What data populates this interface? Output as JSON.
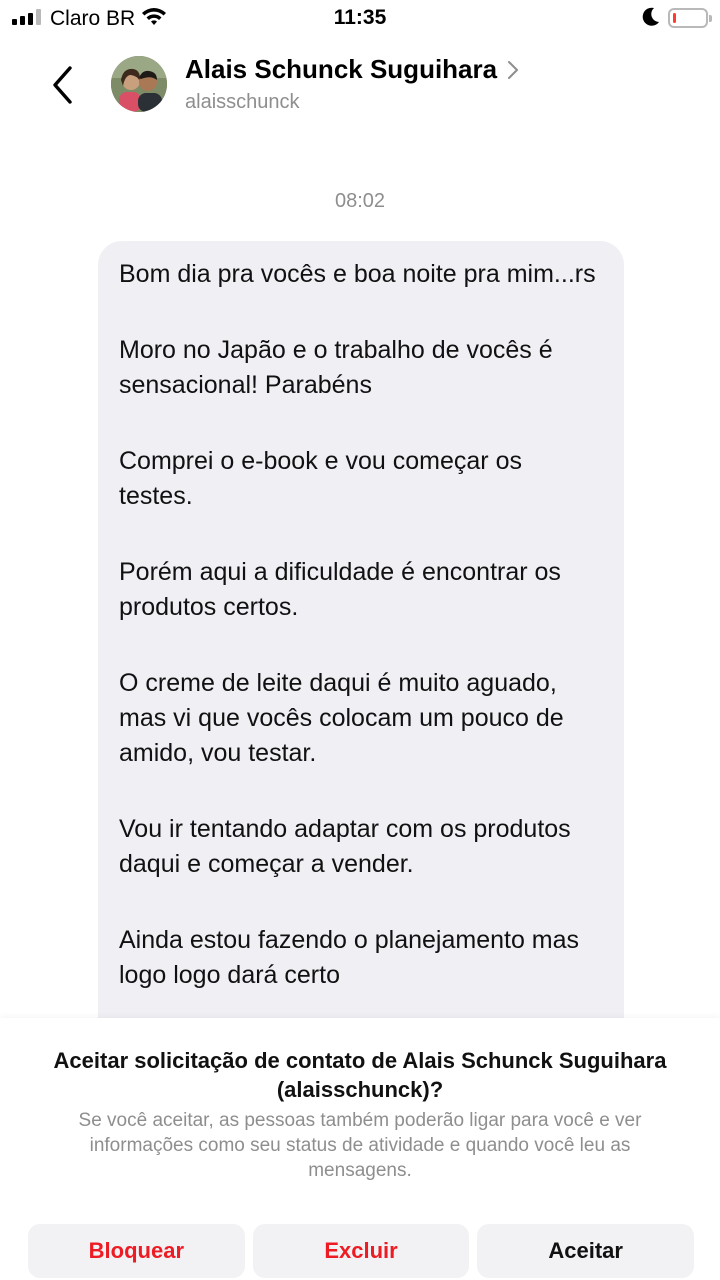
{
  "status_bar": {
    "carrier": "Claro BR",
    "time": "11:35",
    "battery_level": 0.1,
    "battery_color": "#ff3b30"
  },
  "header": {
    "back_icon": "chevron-left-icon",
    "name": "Alais Schunck Suguihara",
    "handle": "alaisschunck",
    "chevron_icon": "chevron-right-icon"
  },
  "thread": {
    "timestamp": "08:02",
    "message_paragraphs": [
      "Bom dia pra vocês e boa noite pra mim...rs",
      "Moro no Japão e o trabalho de vocês é sensacional! Parabéns",
      "Comprei o e-book e vou começar os testes.",
      "Porém aqui a dificuldade é encontrar os produtos certos.",
      "O creme de leite daqui é muito aguado, mas vi que vocês colocam um pouco de amido, vou testar.",
      "Vou ir tentando adaptar com os produtos daqui e começar a vender.",
      "Ainda estou fazendo o planejamento mas logo logo dará certo"
    ]
  },
  "request": {
    "title": "Aceitar solicitação de contato de Alais Schunck Suguihara (alaisschunck)?",
    "description": "Se você aceitar, as pessoas também poderão ligar para você e ver informações como seu status de atividade e quando você leu as mensagens.",
    "buttons": {
      "block": "Bloquear",
      "delete": "Excluir",
      "accept": "Aceitar"
    }
  },
  "colors": {
    "destructive": "#ed1c24",
    "bubble": "#efeff4",
    "secondary_text": "#8e8e8e"
  }
}
